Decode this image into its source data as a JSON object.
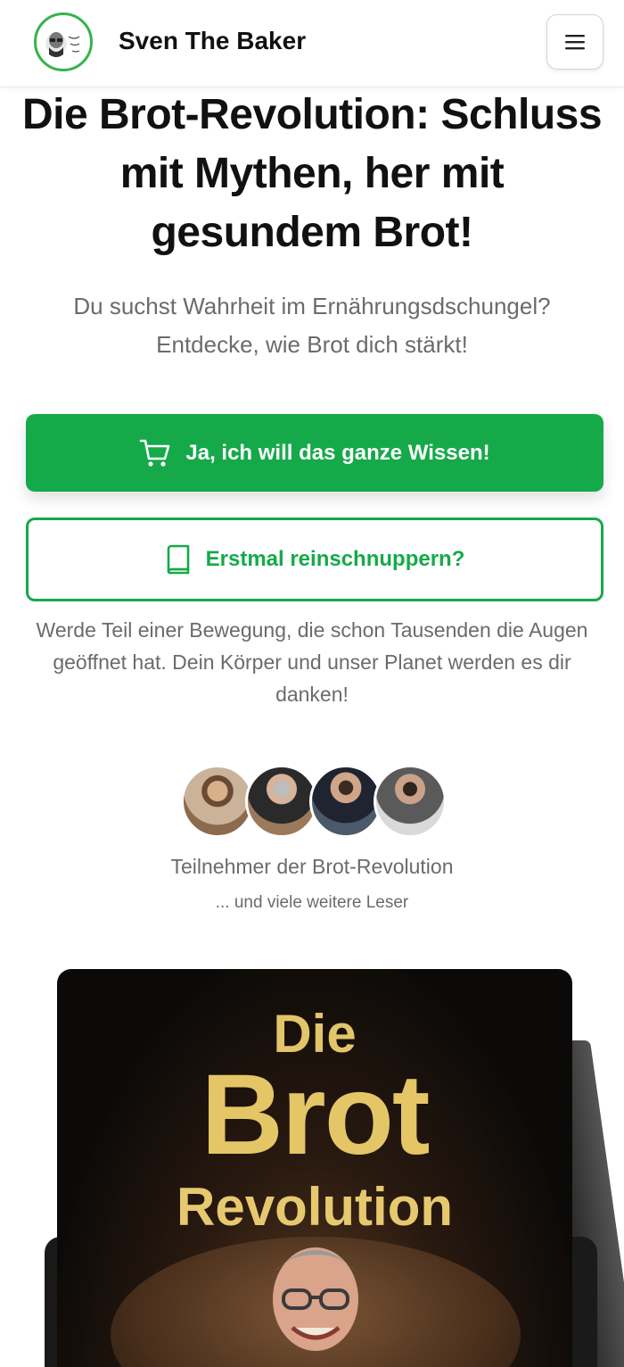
{
  "header": {
    "brand": "Sven The Baker",
    "logo_icon": "sven-the-baker-logo",
    "menu_icon": "hamburger-menu-icon"
  },
  "hero": {
    "title": "Die Brot-Revolution: Schluss mit Mythen, her mit gesundem Brot!",
    "subtitle": "Du suchst Wahrheit im Ernährungsdschungel? Entdecke, wie Brot dich stärkt!"
  },
  "cta_primary": {
    "label": "Ja, ich will das ganze Wissen!",
    "icon": "shopping-cart-icon",
    "color": "#16a94a"
  },
  "cta_secondary": {
    "label": "Erstmal reinschnuppern?",
    "icon": "book-icon",
    "color": "#16a94a"
  },
  "join_text": "Werde Teil einer Bewegung, die schon Tausenden die Augen geöffnet hat. Dein Körper und unser Planet werden es dir danken!",
  "social_proof": {
    "participants_label": "Teilnehmer der Brot-Revolution",
    "more_label": "... und viele weitere Leser"
  },
  "book": {
    "line1": "Die",
    "line2": "Brot",
    "line3": "Revolution"
  }
}
